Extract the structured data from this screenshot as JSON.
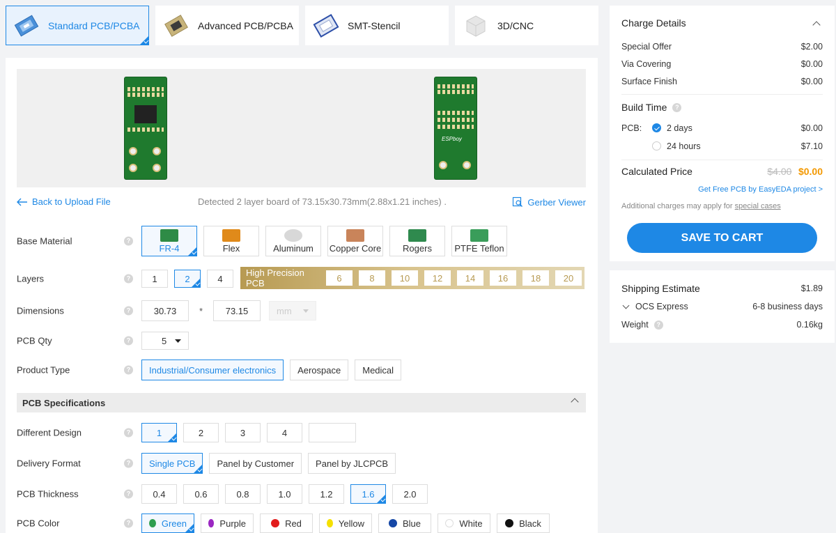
{
  "tabs": [
    {
      "label": "Standard PCB/PCBA",
      "active": true,
      "icon": "standard-pcb-icon"
    },
    {
      "label": "Advanced PCB/PCBA",
      "active": false,
      "icon": "advanced-pcb-icon"
    },
    {
      "label": "SMT-Stencil",
      "active": false,
      "icon": "smt-stencil-icon"
    },
    {
      "label": "3D/CNC",
      "active": false,
      "icon": "3d-cnc-icon"
    }
  ],
  "upload": {
    "back_label": "Back to Upload File",
    "detected": "Detected 2 layer board of 73.15x30.73mm(2.88x1.21 inches) .",
    "gerber_label": "Gerber Viewer"
  },
  "boards": {
    "back_label": "ESPboy"
  },
  "base_material": {
    "label": "Base Material",
    "options": [
      "FR-4",
      "Flex",
      "Aluminum",
      "Copper Core",
      "Rogers",
      "PTFE Teflon"
    ],
    "selected": "FR-4"
  },
  "layers": {
    "label": "Layers",
    "options": [
      "1",
      "2",
      "4"
    ],
    "selected": "2",
    "hp_title": "High Precision PCB",
    "hp_options": [
      "6",
      "8",
      "10",
      "12",
      "14",
      "16",
      "18",
      "20"
    ]
  },
  "dimensions": {
    "label": "Dimensions",
    "width": "30.73",
    "sep": "*",
    "height": "73.15",
    "unit": "mm"
  },
  "qty": {
    "label": "PCB Qty",
    "value": "5"
  },
  "product_type": {
    "label": "Product Type",
    "options": [
      "Industrial/Consumer electronics",
      "Aerospace",
      "Medical"
    ],
    "selected": "Industrial/Consumer electronics"
  },
  "spec_section": {
    "title": "PCB Specifications"
  },
  "different_design": {
    "label": "Different Design",
    "options": [
      "1",
      "2",
      "3",
      "4"
    ],
    "custom": "",
    "selected": "1"
  },
  "delivery_format": {
    "label": "Delivery Format",
    "options": [
      "Single PCB",
      "Panel by Customer",
      "Panel by JLCPCB"
    ],
    "selected": "Single PCB"
  },
  "thickness": {
    "label": "PCB Thickness",
    "options": [
      "0.4",
      "0.6",
      "0.8",
      "1.0",
      "1.2",
      "1.6",
      "2.0"
    ],
    "selected": "1.6"
  },
  "color": {
    "label": "PCB Color",
    "options": [
      {
        "name": "Green",
        "hex": "#2e9e4f"
      },
      {
        "name": "Purple",
        "hex": "#9b27c2"
      },
      {
        "name": "Red",
        "hex": "#e21c1c"
      },
      {
        "name": "Yellow",
        "hex": "#f5e000"
      },
      {
        "name": "Blue",
        "hex": "#1547a6"
      },
      {
        "name": "White",
        "hex": "#ffffff"
      },
      {
        "name": "Black",
        "hex": "#111111"
      }
    ],
    "selected": "Green"
  },
  "charge": {
    "title": "Charge Details",
    "lines": [
      {
        "label": "Special Offer",
        "value": "$2.00"
      },
      {
        "label": "Via Covering",
        "value": "$0.00"
      },
      {
        "label": "Surface Finish",
        "value": "$0.00"
      }
    ],
    "build_time_title": "Build Time",
    "build_prefix": "PCB:",
    "build_options": [
      {
        "label": "2 days",
        "price": "$0.00",
        "selected": true
      },
      {
        "label": "24 hours",
        "price": "$7.10",
        "selected": false
      }
    ],
    "calculated_label": "Calculated Price",
    "old_price": "$4.00",
    "new_price": "$0.00",
    "free_link": "Get Free PCB by EasyEDA project >",
    "additional_prefix": "Additional charges may apply for",
    "additional_link": "special cases",
    "save_label": "SAVE TO CART"
  },
  "shipping": {
    "title": "Shipping Estimate",
    "price": "$1.89",
    "method": "OCS Express",
    "eta": "6-8 business days",
    "weight_label": "Weight",
    "weight": "0.16kg"
  },
  "colors": {
    "accent": "#1e88e5",
    "price_orange": "#f39800",
    "gold": "#b79a52"
  }
}
